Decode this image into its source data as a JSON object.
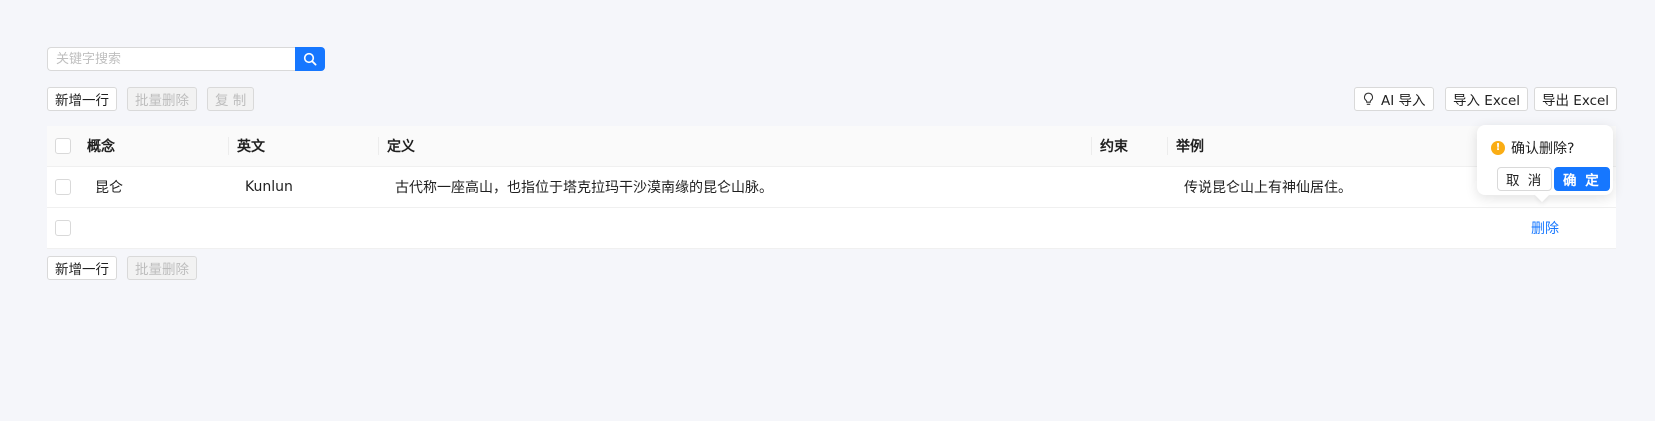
{
  "search": {
    "placeholder": "关键字搜索"
  },
  "icons": {
    "search": "search-icon",
    "ai": "lightbulb-icon",
    "warning": "exclamation-circle-icon"
  },
  "colors": {
    "primary": "#1677ff",
    "warning": "#faad14",
    "background": "#f5f6fa"
  },
  "toolbar_top": {
    "add_row": "新增一行",
    "batch_delete": "批量删除",
    "copy": "复 制",
    "ai_import": "AI 导入",
    "import_excel": "导入 Excel",
    "export_excel": "导出 Excel"
  },
  "table": {
    "columns": [
      "概念",
      "英文",
      "定义",
      "约束",
      "举例"
    ],
    "rows": [
      {
        "concept": "昆仑",
        "english": "Kunlun",
        "definition": "古代称一座高山，也指位于塔克拉玛干沙漠南缘的昆仑山脉。",
        "constraint": "",
        "example": "传说昆仑山上有神仙居住。",
        "action": ""
      },
      {
        "concept": "",
        "english": "",
        "definition": "",
        "constraint": "",
        "example": "",
        "action": "删除"
      }
    ]
  },
  "toolbar_bottom": {
    "add_row": "新增一行",
    "batch_delete": "批量删除"
  },
  "popconfirm": {
    "title": "确认删除?",
    "cancel": "取 消",
    "ok": "确 定"
  }
}
